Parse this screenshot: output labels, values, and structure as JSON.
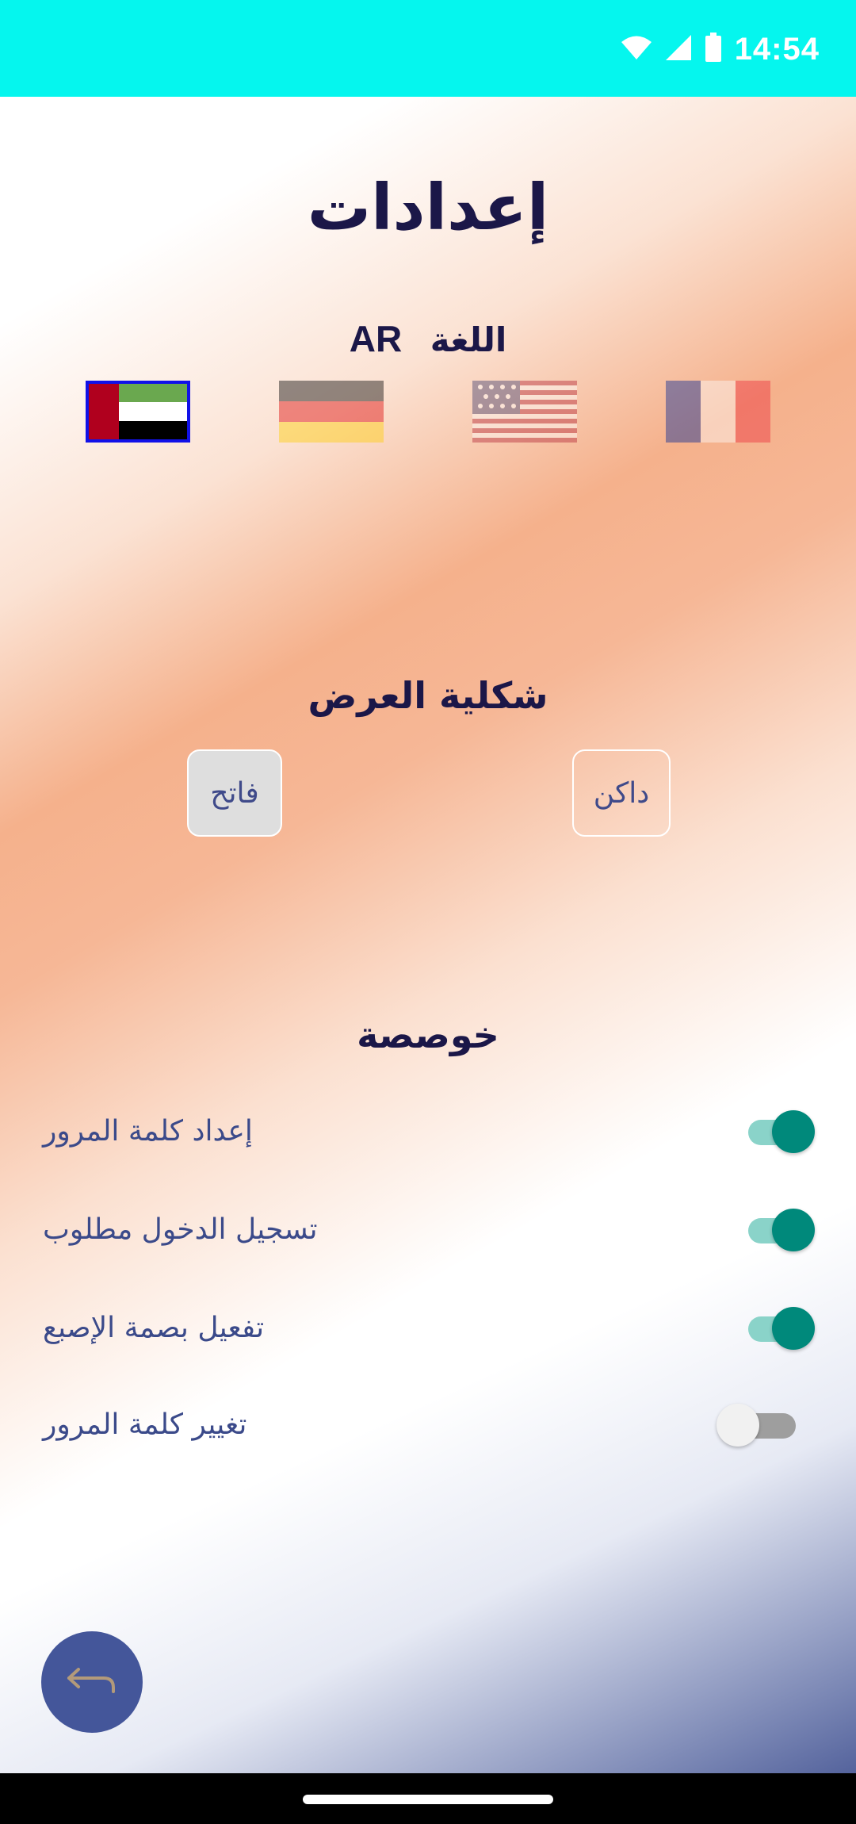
{
  "status_bar": {
    "time": "14:54",
    "icons": [
      "wifi-icon",
      "cell-signal-icon",
      "battery-icon"
    ]
  },
  "page": {
    "title": "إعدادات"
  },
  "language": {
    "label": "اللغة",
    "current_code": "AR",
    "flags": [
      {
        "name": "uae-flag",
        "selected": true
      },
      {
        "name": "germany-flag",
        "selected": false
      },
      {
        "name": "usa-flag",
        "selected": false
      },
      {
        "name": "france-flag",
        "selected": false
      }
    ]
  },
  "display_mode": {
    "title": "شكلية العرض",
    "light_label": "فاتح",
    "dark_label": "داكن",
    "selected": "light"
  },
  "privacy": {
    "title": "خوصصة",
    "items": [
      {
        "label": "إعداد كلمة المرور",
        "on": true
      },
      {
        "label": "تسجيل الدخول مطلوب",
        "on": true
      },
      {
        "label": "تفعيل بصمة الإصبع",
        "on": true
      },
      {
        "label": "تغيير كلمة المرور",
        "on": false
      }
    ]
  },
  "colors": {
    "status_bar": "#05f6ee",
    "title_text": "#1b1748",
    "toggle_on": "#00897b",
    "fab": "#44569a",
    "selected_flag_border": "#1111e8"
  },
  "back_button": {
    "icon": "back-arrow-icon"
  }
}
